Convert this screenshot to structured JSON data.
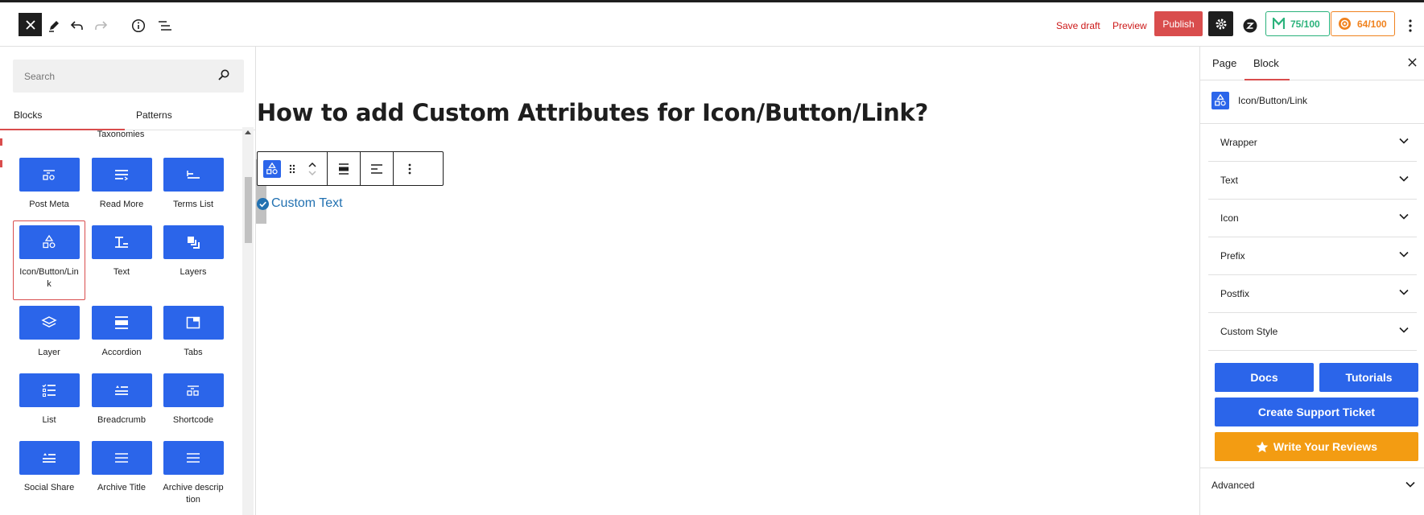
{
  "topbar": {
    "save_draft": "Save draft",
    "preview": "Preview",
    "publish": "Publish",
    "score_seo": "75/100",
    "score_readability": "64/100",
    "colors": {
      "seo": "#2ab27b",
      "readability": "#f0821e",
      "publish": "#d94d4d"
    }
  },
  "inserter": {
    "search_placeholder": "Search",
    "tabs": [
      "Blocks",
      "Patterns"
    ],
    "category": "Taxonomies",
    "blocks": [
      {
        "label": "Post Meta",
        "icon": "post-meta-icon"
      },
      {
        "label": "Read More",
        "icon": "read-more-icon"
      },
      {
        "label": "Terms List",
        "icon": "terms-list-icon"
      },
      {
        "label": "Icon/Button/Link",
        "icon": "icon-button-link-icon",
        "selected": true
      },
      {
        "label": "Text",
        "icon": "text-icon"
      },
      {
        "label": "Layers",
        "icon": "layers-icon"
      },
      {
        "label": "Layer",
        "icon": "layer-icon"
      },
      {
        "label": "Accordion",
        "icon": "accordion-icon"
      },
      {
        "label": "Tabs",
        "icon": "tabs-icon"
      },
      {
        "label": "List",
        "icon": "list-icon"
      },
      {
        "label": "Breadcrumb",
        "icon": "breadcrumb-icon"
      },
      {
        "label": "Shortcode",
        "icon": "shortcode-icon"
      },
      {
        "label": "Social Share",
        "icon": "social-share-icon"
      },
      {
        "label": "Archive Title",
        "icon": "archive-title-icon"
      },
      {
        "label": "Archive description",
        "icon": "archive-description-icon"
      }
    ],
    "tile_color": "#2b65ea"
  },
  "editor": {
    "title": "How to add Custom Attributes for Icon/Button/Link?",
    "custom_text": "Custom Text",
    "link_color": "#2271b1"
  },
  "sidebar": {
    "tabs": [
      "Page",
      "Block"
    ],
    "block_name": "Icon/Button/Link",
    "sections": [
      "Wrapper",
      "Text",
      "Icon",
      "Prefix",
      "Postfix",
      "Custom Style"
    ],
    "buttons": {
      "docs": "Docs",
      "tutorials": "Tutorials",
      "support": "Create Support Ticket",
      "reviews": "Write Your Reviews"
    },
    "advanced": "Advanced"
  }
}
